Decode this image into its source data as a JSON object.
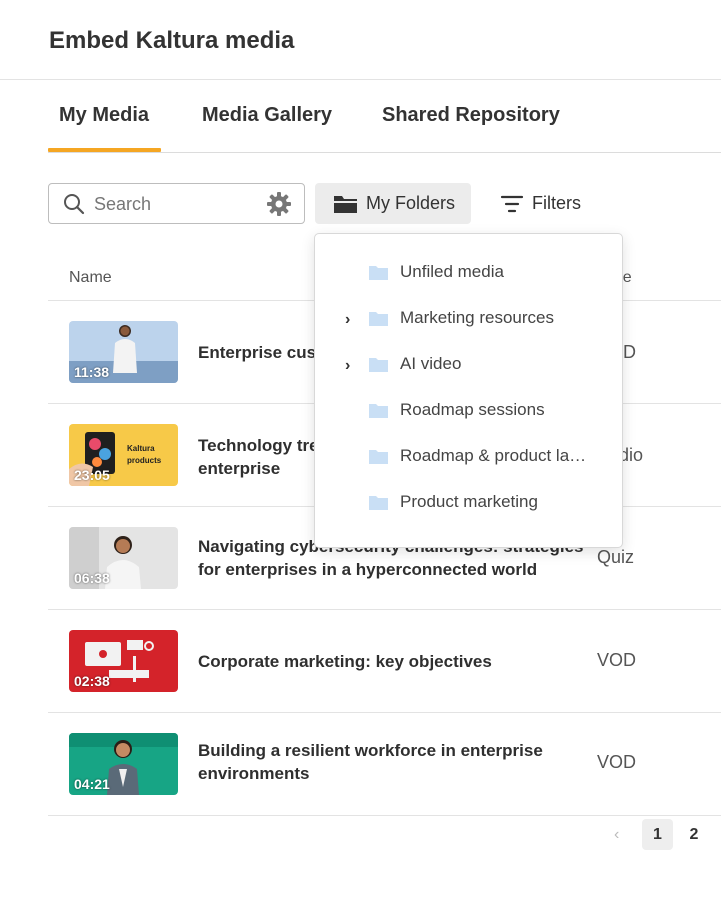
{
  "header": {
    "title": "Embed Kaltura media"
  },
  "tabs": [
    {
      "label": "My Media",
      "active": true
    },
    {
      "label": "Media Gallery",
      "active": false
    },
    {
      "label": "Shared Repository",
      "active": false
    }
  ],
  "toolbar": {
    "search_placeholder": "Search",
    "folders_label": "My Folders",
    "filters_label": "Filters"
  },
  "table": {
    "columns": [
      "Name",
      "Type"
    ],
    "rows": [
      {
        "title": "Enterprise cust",
        "duration": "11:38",
        "type": "VOD",
        "thumb": "person-blue"
      },
      {
        "title": "Technology tre",
        "title_line2": "enterprise",
        "duration": "23:05",
        "type": "Audio",
        "thumb": "kaltura-products",
        "thumb_text_1": "Kaltura",
        "thumb_text_2": "products"
      },
      {
        "title": "Navigating cybersecurity challenges: strategies",
        "title_line2": "for enterprises in a hyperconnected world",
        "duration": "06:38",
        "type": "Quiz",
        "thumb": "person-grey"
      },
      {
        "title": "Corporate marketing: key objectives",
        "duration": "02:38",
        "type": "VOD",
        "thumb": "red-marketing"
      },
      {
        "title": "Building a resilient workforce in enterprise",
        "title_line2": "environments",
        "duration": "04:21",
        "type": "VOD",
        "thumb": "person-green"
      }
    ]
  },
  "pagination": {
    "prev": "‹",
    "pages": [
      "1",
      "2"
    ],
    "current": "1"
  },
  "folders_menu": {
    "items": [
      {
        "label": "Unfiled media",
        "expandable": false
      },
      {
        "label": "Marketing resources",
        "expandable": true
      },
      {
        "label": "AI video",
        "expandable": true
      },
      {
        "label": "Roadmap sessions",
        "expandable": false
      },
      {
        "label": "Roadmap & product la…",
        "expandable": false
      },
      {
        "label": "Product marketing",
        "expandable": false
      }
    ],
    "chevron": "›"
  },
  "colors": {
    "accent": "#f5a623",
    "folder": "#c9dff5"
  }
}
